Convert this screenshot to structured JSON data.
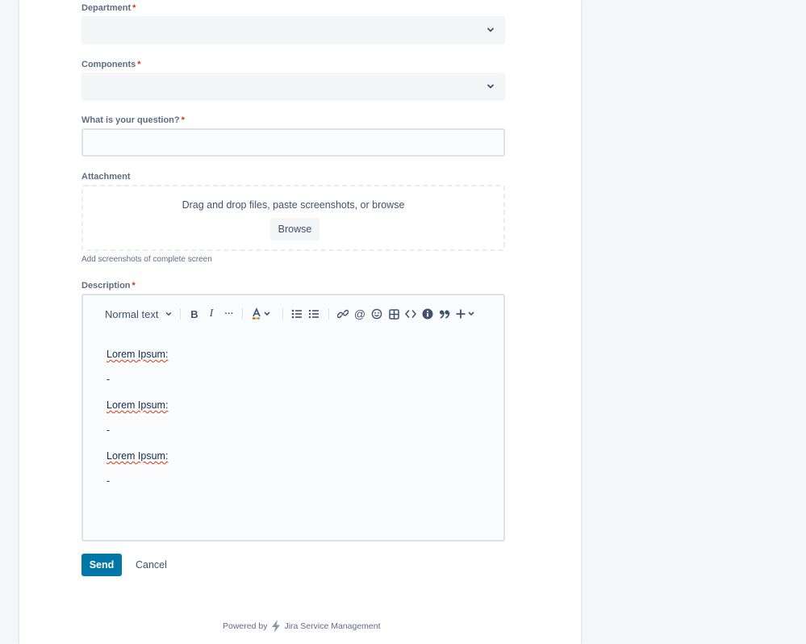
{
  "form": {
    "required_marker": "*",
    "department": {
      "label": "Department",
      "value": ""
    },
    "components": {
      "label": "Components",
      "value": ""
    },
    "question": {
      "label": "What is your question?",
      "value": ""
    },
    "attachment": {
      "label": "Attachment",
      "drop_text": "Drag and drop files, paste screenshots, or browse",
      "browse_label": "Browse",
      "helper_text": "Add screenshots of complete screen"
    },
    "description": {
      "label": "Description",
      "toolbar": {
        "text_style": "Normal text",
        "icons": [
          "chevron-down-icon",
          "bold-icon",
          "italic-icon",
          "more-icon",
          "text-color-icon",
          "bullet-list-icon",
          "numbered-list-icon",
          "link-icon",
          "mention-icon",
          "emoji-icon",
          "table-icon",
          "code-icon",
          "info-icon",
          "quote-icon",
          "insert-icon"
        ],
        "bold_glyph": "B",
        "italic_glyph": "I",
        "more_glyph": "···",
        "mention_glyph": "@",
        "code_glyph": "<>",
        "quote_glyph": "99",
        "insert_glyph": "+"
      },
      "lines": [
        "Lorem Ipsum:",
        "-",
        "Lorem Ipsum:",
        "-",
        "Lorem Ipsum:",
        "-"
      ]
    },
    "send_label": "Send",
    "cancel_label": "Cancel"
  },
  "footer": {
    "powered_by": "Powered by",
    "product": "Jira Service Management"
  },
  "colors": {
    "primary": "#0077a6",
    "required": "#de350b",
    "label": "#5e6c84"
  }
}
